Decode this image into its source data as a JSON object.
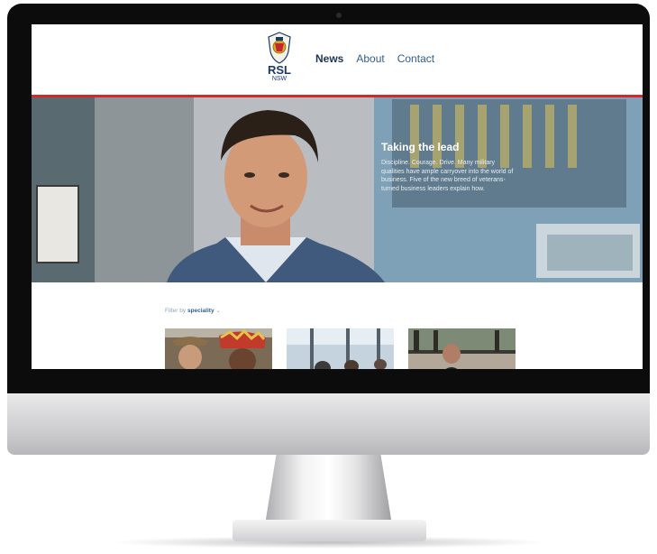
{
  "site": {
    "logo": {
      "text": "RSL",
      "subtext": "NSW"
    },
    "nav": [
      {
        "label": "News",
        "active": true
      },
      {
        "label": "About",
        "active": false
      },
      {
        "label": "Contact",
        "active": false
      }
    ]
  },
  "hero": {
    "title": "Taking the lead",
    "body": "Discipline. Courage. Drive. Many military qualities have ample carryover into the world of business. Five of the new breed of veterans-turned business leaders explain how."
  },
  "filter": {
    "prefix": "Filter by",
    "value": "speciality",
    "chevron": "⌄"
  },
  "colors": {
    "accent_red": "#d8262b",
    "nav_active": "#1a3555",
    "nav_link": "#2f5f8a"
  }
}
